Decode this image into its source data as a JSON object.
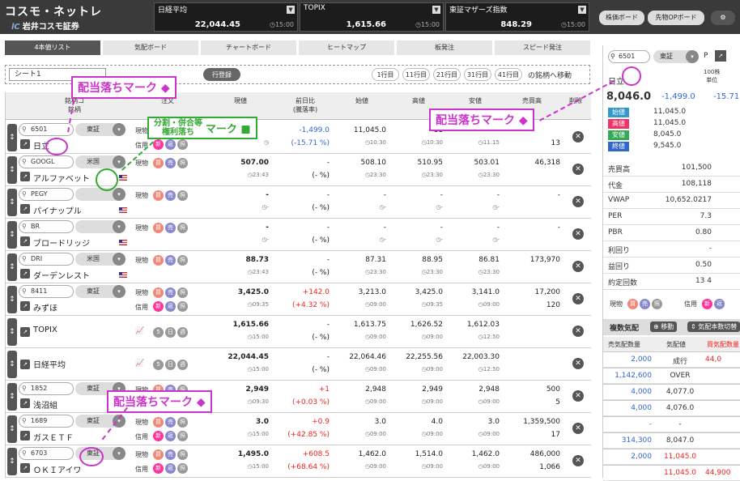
{
  "app": {
    "logo_main": "コスモ・ネットレ",
    "logo_sub": "岩井コスモ証券"
  },
  "indices": [
    {
      "name": "日経平均",
      "value": "22,044.45",
      "time": "15:00"
    },
    {
      "name": "TOPIX",
      "value": "1,615.66",
      "time": "15:00"
    },
    {
      "name": "東証マザーズ指数",
      "value": "848.29",
      "time": "15:00"
    }
  ],
  "top_buttons": {
    "board": "株価ボード",
    "op_board": "先物OPボード"
  },
  "tabs": [
    "4本値リスト",
    "気配ボード",
    "チャートボード",
    "ヒートマップ",
    "板発注",
    "スピード発注"
  ],
  "sheet": {
    "name": "シート1",
    "register": "行登録",
    "rows": [
      "1行目",
      "11行目",
      "21行目",
      "31行目",
      "41行目"
    ],
    "suffix": "の銘柄へ移動"
  },
  "headers": {
    "code": "銘柄コ",
    "name": "銘柄",
    "order": "注文",
    "price": "現値",
    "change1": "前日比",
    "change2": "(騰落率)",
    "open": "始値",
    "high": "高値",
    "low": "安値",
    "volume": "売買高",
    "delete": "削除"
  },
  "rows": [
    {
      "code": "6501",
      "market": "東証",
      "name": "日立",
      "t1": "現物",
      "t2": "信用",
      "price": "",
      "ptime": "",
      "chg": "-1,499.0",
      "chgp": "(-15.71 %)",
      "open": "11,045.0",
      "otime": "10:30",
      "high": "11",
      "htime": "10:30",
      "low": "",
      "ltime": "11:15",
      "vol": "",
      "vol2": "13"
    },
    {
      "code": "GOOGL",
      "market": "米国",
      "name": "アルファベット",
      "t1": "現物",
      "t2": "",
      "price": "507.00",
      "ptime": "23:43",
      "chg": "-",
      "chgp": "(- %)",
      "open": "508.10",
      "otime": "23:30",
      "high": "510.95",
      "htime": "23:30",
      "low": "503.01",
      "ltime": "23:30",
      "vol": "46,318",
      "vol2": ""
    },
    {
      "code": "PEGY",
      "market": "",
      "name": "パイナップル",
      "t1": "現物",
      "t2": "",
      "price": "-",
      "ptime": "-",
      "chg": "-",
      "chgp": "(- %)",
      "open": "-",
      "otime": "-",
      "high": "-",
      "htime": "-",
      "low": "-",
      "ltime": "-",
      "vol": "-",
      "vol2": ""
    },
    {
      "code": "BR",
      "market": "",
      "name": "ブロードリッジ",
      "t1": "現物",
      "t2": "",
      "price": "-",
      "ptime": "-",
      "chg": "-",
      "chgp": "(- %)",
      "open": "-",
      "otime": "-",
      "high": "-",
      "htime": "-",
      "low": "-",
      "ltime": "-",
      "vol": "-",
      "vol2": ""
    },
    {
      "code": "DRI",
      "market": "米国",
      "name": "ダーデンレスト",
      "t1": "現物",
      "t2": "",
      "price": "88.73",
      "ptime": "23:43",
      "chg": "-",
      "chgp": "(- %)",
      "open": "87.31",
      "otime": "23:30",
      "high": "88.95",
      "htime": "23:30",
      "low": "86.81",
      "ltime": "23:30",
      "vol": "173,970",
      "vol2": ""
    },
    {
      "code": "8411",
      "market": "東証",
      "name": "みずほ",
      "t1": "現物",
      "t2": "信用",
      "price": "3,425.0",
      "ptime": "09:35",
      "chg": "+142.0",
      "chgp": "(+4.32 %)",
      "open": "3,213.0",
      "otime": "09:00",
      "high": "3,425.0",
      "htime": "09:35",
      "low": "3,141.0",
      "ltime": "09:00",
      "vol": "17,200",
      "vol2": "120"
    },
    {
      "code": "",
      "market": "",
      "name": "TOPIX",
      "t1": "",
      "t2": "",
      "price": "1,615.66",
      "ptime": "15:00",
      "chg": "-",
      "chgp": "(- %)",
      "open": "1,613.75",
      "otime": "09:00",
      "high": "1,626.52",
      "htime": "09:00",
      "low": "1,612.03",
      "ltime": "12:50",
      "vol": "",
      "vol2": ""
    },
    {
      "code": "",
      "market": "",
      "name": "日経平均",
      "t1": "",
      "t2": "",
      "price": "22,044.45",
      "ptime": "15:00",
      "chg": "-",
      "chgp": "(- %)",
      "open": "22,064.46",
      "otime": "09:00",
      "high": "22,255.56",
      "htime": "09:00",
      "low": "22,003.30",
      "ltime": "12:50",
      "vol": "",
      "vol2": ""
    },
    {
      "code": "1852",
      "market": "東証",
      "name": "浅沼組",
      "t1": "現物",
      "t2": "信用",
      "price": "2,949",
      "ptime": "09:30",
      "chg": "+1",
      "chgp": "(+0.03 %)",
      "open": "2,948",
      "otime": "09:00",
      "high": "2,949",
      "htime": "09:00",
      "low": "2,948",
      "ltime": "09:00",
      "vol": "500",
      "vol2": "5"
    },
    {
      "code": "1689",
      "market": "東証",
      "name": "ガスＥＴＦ",
      "t1": "現物",
      "t2": "信用",
      "price": "3.0",
      "ptime": "15:00",
      "chg": "+0.9",
      "chgp": "(+42.85 %)",
      "open": "3.0",
      "otime": "09:00",
      "high": "4.0",
      "htime": "09:00",
      "low": "3.0",
      "ltime": "09:00",
      "vol": "1,359,500",
      "vol2": "17"
    },
    {
      "code": "6703",
      "market": "東証",
      "name": "ＯＫＩアイワ",
      "t1": "現物",
      "t2": "信用",
      "price": "1,495.0",
      "ptime": "15:00",
      "chg": "+608.5",
      "chgp": "(+68.64 %)",
      "open": "1,462.0",
      "otime": "09:00",
      "high": "1,514.0",
      "htime": "09:00",
      "low": "1,462.0",
      "ltime": "09:00",
      "vol": "486,000",
      "vol2": "1,066"
    }
  ],
  "side": {
    "code": "6501",
    "market": "東証",
    "name": "日立",
    "unit1": "100株",
    "unit2": "単位",
    "price": "8,046.0",
    "chg": "-1,499.0",
    "chgp": "-15.71",
    "ohl": [
      {
        "k": "始値",
        "v": "11,045.0",
        "c": "#39c"
      },
      {
        "k": "高値",
        "v": "11,045.0",
        "c": "#e36"
      },
      {
        "k": "安値",
        "v": "8,045.0",
        "c": "#3a5"
      },
      {
        "k": "終値",
        "v": "9,545.0",
        "c": "#36c"
      }
    ],
    "stats": [
      {
        "k": "売買高",
        "v": "101,500"
      },
      {
        "k": "代金",
        "v": "108,118"
      },
      {
        "k": "VWAP",
        "v": "10,652.0217"
      },
      {
        "k": "PER",
        "v": "7.3"
      },
      {
        "k": "PBR",
        "v": "0.80"
      },
      {
        "k": "利回り",
        "v": "-"
      },
      {
        "k": "益回り",
        "v": "0.50"
      },
      {
        "k": "約定回数",
        "v": "13   4"
      }
    ],
    "trade1": "現物",
    "trade2": "信用",
    "depth_title": "複数気配",
    "move": "移動",
    "count_label": "気配本数切替",
    "depth_headers": [
      "売気配数量",
      "気配値",
      "買気配数量"
    ],
    "depth": [
      {
        "s": "2,000",
        "p": "成行",
        "b": "44,0"
      },
      {
        "s": "1,142,600",
        "p": "OVER",
        "b": ""
      },
      {
        "s": "4,000",
        "p": "4,077.0",
        "b": ""
      },
      {
        "s": "4,000",
        "p": "4,076.0",
        "b": ""
      },
      {
        "s": "-",
        "p": "-",
        "b": ""
      },
      {
        "s": "314,300",
        "p": "8,047.0",
        "b": ""
      },
      {
        "s": "2,000",
        "p": "11,045.0",
        "b": ""
      },
      {
        "s": "",
        "p": "11,045.0",
        "b": "44,900"
      }
    ]
  },
  "callouts": {
    "dividend": "配当落ちマーク ◆",
    "split1": "分割・併合等",
    "split2": "権利落ち",
    "split_mark": "マーク ■"
  }
}
